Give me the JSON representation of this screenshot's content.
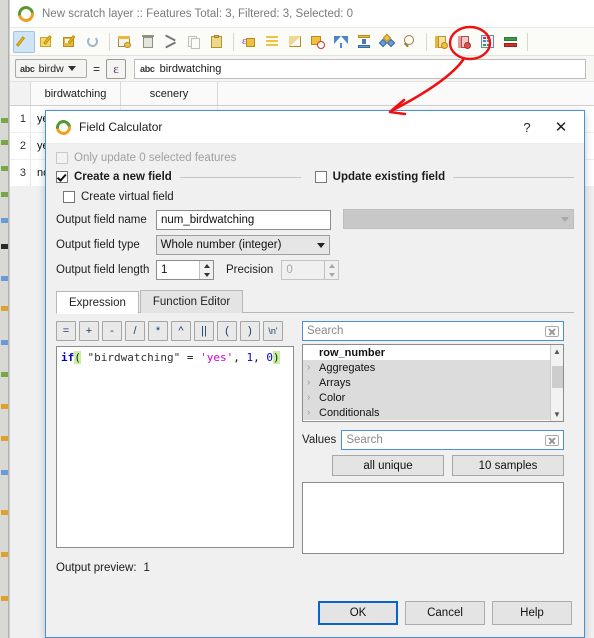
{
  "attribute_table": {
    "window_title": "New scratch layer :: Features Total: 3, Filtered: 3, Selected: 0",
    "logo_icon": "qgis-logo-icon",
    "toolbar": [
      {
        "name": "toggle-editing-icon",
        "title": "Toggle editing mode",
        "active": true
      },
      {
        "name": "save-edits-icon",
        "title": "Save edits"
      },
      {
        "name": "save-layer-edits-icon",
        "title": "Save layer edits"
      },
      {
        "name": "reload-table-icon",
        "title": "Reload the table"
      },
      {
        "sep": true
      },
      {
        "name": "add-feature-icon",
        "title": "Add feature"
      },
      {
        "name": "delete-selected-icon",
        "title": "Delete selected features"
      },
      {
        "name": "cut-features-icon",
        "title": "Cut selected rows to clipboard"
      },
      {
        "name": "copy-features-icon",
        "title": "Copy selected rows to clipboard"
      },
      {
        "name": "paste-features-icon",
        "title": "Paste features from clipboard"
      },
      {
        "sep": true
      },
      {
        "name": "select-by-expression-icon",
        "title": "Select features using an expression"
      },
      {
        "name": "select-all-icon",
        "title": "Select all features"
      },
      {
        "name": "invert-selection-icon",
        "title": "Invert selection"
      },
      {
        "name": "deselect-all-icon",
        "title": "Deselect all features"
      },
      {
        "name": "filter-icon",
        "title": "Filter / select features"
      },
      {
        "name": "move-selection-to-top-icon",
        "title": "Move selection to top"
      },
      {
        "name": "pan-to-selected-icon",
        "title": "Pan map to selected rows"
      },
      {
        "name": "zoom-to-selected-icon",
        "title": "Zoom map to selected rows"
      },
      {
        "sep": true
      },
      {
        "name": "new-field-icon",
        "title": "New field"
      },
      {
        "name": "delete-field-icon",
        "title": "Delete field"
      },
      {
        "name": "open-field-calculator-icon",
        "title": "Open field calculator",
        "highlighted": true
      },
      {
        "name": "conditional-formatting-icon",
        "title": "Conditional formatting"
      },
      {
        "sep": true
      }
    ],
    "field_bar": {
      "field_type_tag": "abc",
      "field_name": "birdw",
      "equals": "=",
      "epsilon": "ε",
      "value_type_tag": "abc",
      "value": "birdwatching"
    },
    "columns": [
      "birdwatching",
      "scenery"
    ],
    "rows": [
      {
        "index": "1",
        "birdwatching": "yes",
        "scenery": ""
      },
      {
        "index": "2",
        "birdwatching": "yes",
        "scenery": ""
      },
      {
        "index": "3",
        "birdwatching": "no",
        "scenery": ""
      }
    ]
  },
  "field_calculator": {
    "title": "Field Calculator",
    "logo_icon": "qgis-logo-icon",
    "help_btn": "?",
    "close_btn": "✕",
    "only_update_selected": {
      "label": "Only update 0 selected features",
      "checked": false,
      "enabled": false
    },
    "create_new_field": {
      "label": "Create a new field",
      "checked": true
    },
    "update_existing_field": {
      "label": "Update existing field",
      "checked": false
    },
    "create_virtual_field": {
      "label": "Create virtual field",
      "checked": false
    },
    "output_field_name": {
      "label": "Output field name",
      "value": "num_birdwatching"
    },
    "output_field_type": {
      "label": "Output field type",
      "value": "Whole number (integer)"
    },
    "output_field_length": {
      "label": "Output field length",
      "value": "1"
    },
    "precision": {
      "label": "Precision",
      "value": "0",
      "enabled": false
    },
    "existing_field_combo": {
      "value": "",
      "enabled": false
    },
    "tabs": [
      {
        "label": "Expression",
        "selected": true
      },
      {
        "label": "Function Editor",
        "selected": false
      }
    ],
    "operator_buttons": [
      "=",
      "+",
      "-",
      "/",
      "*",
      "^",
      "||",
      "(",
      ")",
      "\\n'"
    ],
    "expression": {
      "full_text": "if( \"birdwatching\" = 'yes', 1, 0)",
      "tokens": [
        {
          "text": "if",
          "kind": "function"
        },
        {
          "text": "(",
          "kind": "paren-match"
        },
        {
          "text": " \"birdwatching\" ",
          "kind": "field"
        },
        {
          "text": "= ",
          "kind": "operator"
        },
        {
          "text": "'yes'",
          "kind": "string"
        },
        {
          "text": ", ",
          "kind": "operator"
        },
        {
          "text": "1",
          "kind": "number"
        },
        {
          "text": ", ",
          "kind": "operator"
        },
        {
          "text": "0",
          "kind": "number"
        },
        {
          "text": ")",
          "kind": "paren-match"
        }
      ]
    },
    "function_search": {
      "placeholder": "Search",
      "value": ""
    },
    "function_tree": [
      {
        "label": "row_number",
        "bold": true,
        "expandable": false,
        "highlighted": false
      },
      {
        "label": "Aggregates",
        "bold": false,
        "expandable": true,
        "highlighted": true
      },
      {
        "label": "Arrays",
        "bold": false,
        "expandable": true,
        "highlighted": true
      },
      {
        "label": "Color",
        "bold": false,
        "expandable": true,
        "highlighted": true
      },
      {
        "label": "Conditionals",
        "bold": false,
        "expandable": true,
        "highlighted": true
      }
    ],
    "values": {
      "label": "Values",
      "search_placeholder": "Search",
      "search_value": "",
      "all_unique_label": "all unique",
      "samples_label": "10 samples",
      "list_items": []
    },
    "output_preview": {
      "label": "Output preview:",
      "value": "1"
    },
    "buttons": [
      {
        "label": "OK",
        "default": true
      },
      {
        "label": "Cancel",
        "default": false
      },
      {
        "label": "Help",
        "default": false
      }
    ]
  },
  "annotation": {
    "color": "#ee1111",
    "shapes": [
      "ellipse-highlight-around-field-calculator-icon",
      "curved-arrow-to-dialog"
    ]
  }
}
